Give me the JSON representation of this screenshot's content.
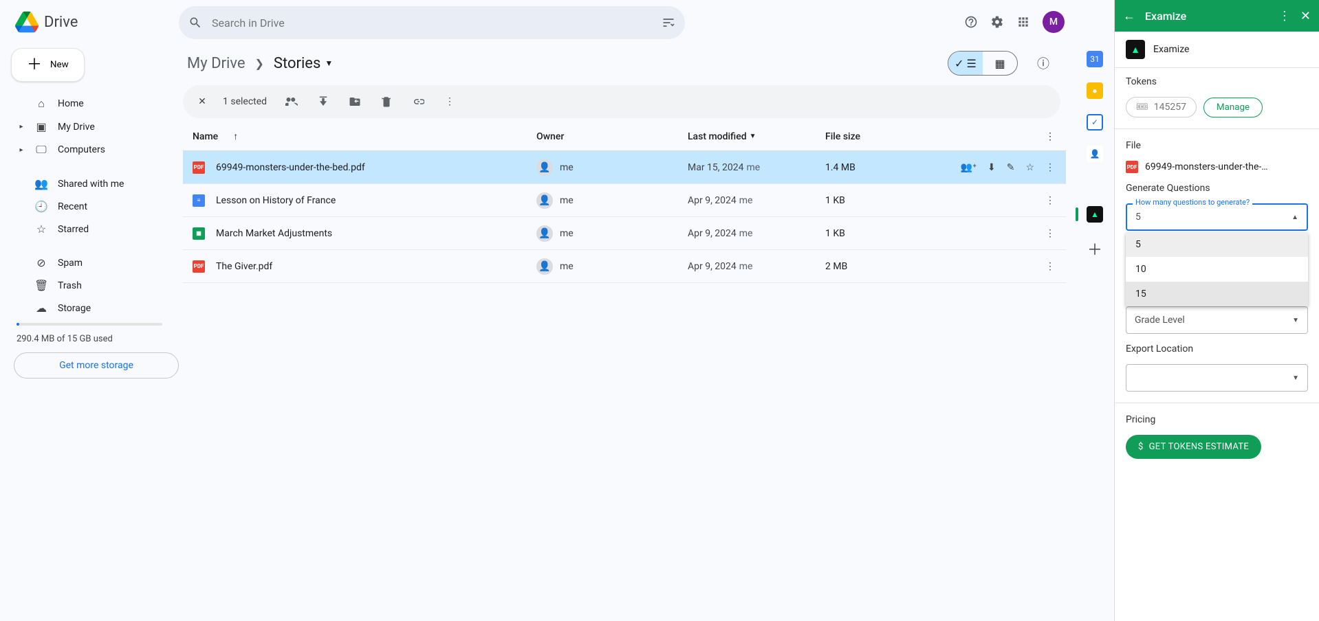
{
  "app": {
    "name": "Drive"
  },
  "search": {
    "placeholder": "Search in Drive"
  },
  "newButton": "New",
  "nav": {
    "home": "Home",
    "mydrive": "My Drive",
    "computers": "Computers",
    "shared": "Shared with me",
    "recent": "Recent",
    "starred": "Starred",
    "spam": "Spam",
    "trash": "Trash",
    "storage": "Storage"
  },
  "storage": {
    "used": "290.4 MB of 15 GB used",
    "cta": "Get more storage"
  },
  "avatar": "M",
  "breadcrumb": {
    "root": "My Drive",
    "current": "Stories"
  },
  "selection": {
    "count": "1 selected"
  },
  "columns": {
    "name": "Name",
    "owner": "Owner",
    "lastmod": "Last modified",
    "size": "File size"
  },
  "files": [
    {
      "type": "pdf",
      "name": "69949-monsters-under-the-bed.pdf",
      "owner": "me",
      "date": "Mar 15, 2024",
      "who": "me",
      "size": "1.4 MB",
      "selected": true
    },
    {
      "type": "doc",
      "name": "Lesson on History of France",
      "owner": "me",
      "date": "Apr 9, 2024",
      "who": "me",
      "size": "1 KB"
    },
    {
      "type": "sheet",
      "name": "March Market Adjustments",
      "owner": "me",
      "date": "Apr 9, 2024",
      "who": "me",
      "size": "1 KB"
    },
    {
      "type": "pdf",
      "name": "The Giver.pdf",
      "owner": "me",
      "date": "Apr 9, 2024",
      "who": "me",
      "size": "2 MB"
    }
  ],
  "panel": {
    "title": "Examize",
    "appName": "Examize",
    "tokensLabel": "Tokens",
    "tokens": "145257",
    "manage": "Manage",
    "fileLabel": "File",
    "fileName": "69949-monsters-under-the-…",
    "genLabel": "Generate Questions",
    "qLabel": "How many questions to generate?",
    "qValue": "5",
    "qOptions": [
      "5",
      "10",
      "15"
    ],
    "tooltip": "15",
    "gradeLabel": "Grade Level",
    "exportLabel": "Export Location",
    "pricingLabel": "Pricing",
    "pricingBtn": "GET TOKENS ESTIMATE"
  }
}
